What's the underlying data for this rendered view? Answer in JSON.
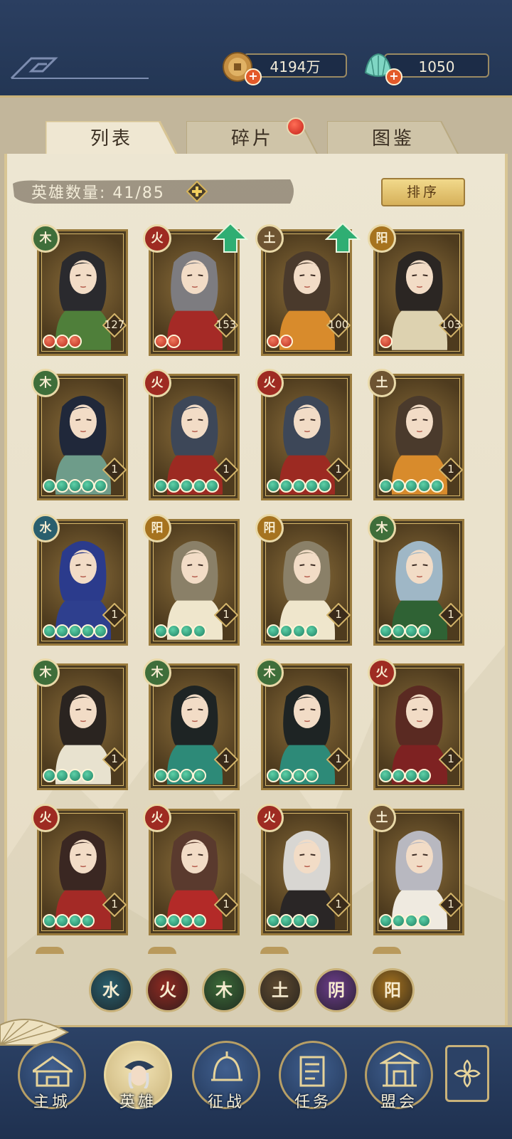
{
  "currency": {
    "coins": {
      "icon": "copper-coin-icon",
      "value": "4194万"
    },
    "jade": {
      "icon": "jade-shell-icon",
      "value": "1050"
    }
  },
  "tabs": [
    {
      "label": "列表",
      "active": true
    },
    {
      "label": "碎片",
      "active": false,
      "has_notification": true
    },
    {
      "label": "图鉴",
      "active": false
    }
  ],
  "hero_count": {
    "label": "英雄数量:",
    "value": "41/85"
  },
  "sort_label": "排序",
  "element_colors": {
    "火": "#9e2b22",
    "木": "#3f6e3a",
    "土": "#6e5432",
    "水": "#2a5f6e",
    "阳": "#a6731f",
    "阴": "#6b3d8a"
  },
  "heroes": [
    {
      "element": "木",
      "element_glyph": "木",
      "level": "127",
      "stars": 3,
      "star_color": "red",
      "upgrade": false,
      "hair": "#2a2a2e",
      "robe": "#4f7f3a"
    },
    {
      "element": "火",
      "element_glyph": "火",
      "level": "153",
      "stars": 2,
      "star_color": "red",
      "upgrade": true,
      "hair": "#7d7c80",
      "robe": "#a52a26"
    },
    {
      "element": "土",
      "element_glyph": "土",
      "level": "100",
      "stars": 2,
      "star_color": "red",
      "upgrade": true,
      "hair": "#4a3a2c",
      "robe": "#d88b2c"
    },
    {
      "element": "阳",
      "element_glyph": "阳",
      "level": "103",
      "stars": 1,
      "star_color": "red",
      "upgrade": false,
      "hair": "#2b2623",
      "robe": "#ddd2b0"
    },
    {
      "element": "木",
      "element_glyph": "木",
      "level": "1",
      "stars": 5,
      "star_color": "green",
      "upgrade": false,
      "hair": "#20283a",
      "robe": "#6e9c8a"
    },
    {
      "element": "火",
      "element_glyph": "火",
      "level": "1",
      "stars": 5,
      "star_color": "green",
      "upgrade": false,
      "hair": "#3d4758",
      "robe": "#9c2a22"
    },
    {
      "element": "火",
      "element_glyph": "火",
      "level": "1",
      "stars": 5,
      "star_color": "green",
      "upgrade": false,
      "hair": "#3d4758",
      "robe": "#9c2a22"
    },
    {
      "element": "土",
      "element_glyph": "土",
      "level": "1",
      "stars": 5,
      "star_color": "green",
      "upgrade": false,
      "hair": "#4a3a2c",
      "robe": "#d88b2c"
    },
    {
      "element": "水",
      "element_glyph": "水",
      "level": "1",
      "stars": 5,
      "star_color": "green",
      "upgrade": false,
      "hair": "#2b3b8c",
      "robe": "#2e3f8e"
    },
    {
      "element": "阳",
      "element_glyph": "阳",
      "level": "1",
      "stars": 4,
      "star_color": "green",
      "upgrade": false,
      "hair": "#8a8068",
      "robe": "#efe6cc"
    },
    {
      "element": "阳",
      "element_glyph": "阳",
      "level": "1",
      "stars": 4,
      "star_color": "green",
      "upgrade": false,
      "hair": "#8a8068",
      "robe": "#efe6cc"
    },
    {
      "element": "木",
      "element_glyph": "木",
      "level": "1",
      "stars": 4,
      "star_color": "green",
      "upgrade": false,
      "hair": "#9fb7c6",
      "robe": "#2f6234"
    },
    {
      "element": "木",
      "element_glyph": "木",
      "level": "1",
      "stars": 4,
      "star_color": "green",
      "upgrade": false,
      "hair": "#2a2420",
      "robe": "#e8e2cf"
    },
    {
      "element": "木",
      "element_glyph": "木",
      "level": "1",
      "stars": 4,
      "star_color": "green",
      "upgrade": false,
      "hair": "#1e2424",
      "robe": "#2d8a78"
    },
    {
      "element": "木",
      "element_glyph": "木",
      "level": "1",
      "stars": 4,
      "star_color": "green",
      "upgrade": false,
      "hair": "#1e2424",
      "robe": "#2d8a78"
    },
    {
      "element": "火",
      "element_glyph": "火",
      "level": "1",
      "stars": 4,
      "star_color": "green",
      "upgrade": false,
      "hair": "#5a2a22",
      "robe": "#7e2222"
    },
    {
      "element": "火",
      "element_glyph": "火",
      "level": "1",
      "stars": 4,
      "star_color": "green",
      "upgrade": false,
      "hair": "#3a2722",
      "robe": "#a42a26"
    },
    {
      "element": "火",
      "element_glyph": "火",
      "level": "1",
      "stars": 4,
      "star_color": "green",
      "upgrade": false,
      "hair": "#5a3a2e",
      "robe": "#b32a28"
    },
    {
      "element": "火",
      "element_glyph": "火",
      "level": "1",
      "stars": 4,
      "star_color": "green",
      "upgrade": false,
      "hair": "#d8d6d2",
      "robe": "#2a2626"
    },
    {
      "element": "土",
      "element_glyph": "土",
      "level": "1",
      "stars": 4,
      "star_color": "green",
      "upgrade": false,
      "hair": "#b8b8c0",
      "robe": "#efeae0"
    }
  ],
  "element_filters": [
    {
      "glyph": "水",
      "name": "water"
    },
    {
      "glyph": "火",
      "name": "fire"
    },
    {
      "glyph": "木",
      "name": "wood"
    },
    {
      "glyph": "土",
      "name": "earth"
    },
    {
      "glyph": "阴",
      "name": "yin"
    },
    {
      "glyph": "阳",
      "name": "yang"
    }
  ],
  "nav": [
    {
      "label": "主城",
      "icon": "city-gate-icon",
      "active": false
    },
    {
      "label": "英雄",
      "icon": "hero-portrait-icon",
      "active": true
    },
    {
      "label": "征战",
      "icon": "war-helmet-icon",
      "active": false
    },
    {
      "label": "任务",
      "icon": "task-scroll-icon",
      "active": false
    },
    {
      "label": "盟会",
      "icon": "alliance-pavilion-icon",
      "active": false
    }
  ],
  "menu_icon": "flower-menu-icon"
}
